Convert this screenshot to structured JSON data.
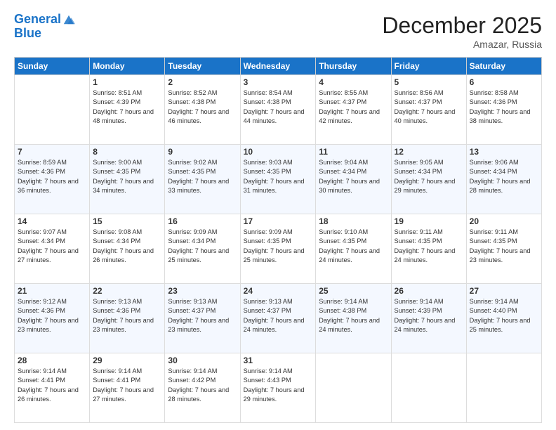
{
  "logo": {
    "line1": "General",
    "line2": "Blue"
  },
  "header": {
    "month": "December 2025",
    "location": "Amazar, Russia"
  },
  "weekdays": [
    "Sunday",
    "Monday",
    "Tuesday",
    "Wednesday",
    "Thursday",
    "Friday",
    "Saturday"
  ],
  "weeks": [
    [
      {
        "day": "",
        "sunrise": "",
        "sunset": "",
        "daylight": ""
      },
      {
        "day": "1",
        "sunrise": "Sunrise: 8:51 AM",
        "sunset": "Sunset: 4:39 PM",
        "daylight": "Daylight: 7 hours and 48 minutes."
      },
      {
        "day": "2",
        "sunrise": "Sunrise: 8:52 AM",
        "sunset": "Sunset: 4:38 PM",
        "daylight": "Daylight: 7 hours and 46 minutes."
      },
      {
        "day": "3",
        "sunrise": "Sunrise: 8:54 AM",
        "sunset": "Sunset: 4:38 PM",
        "daylight": "Daylight: 7 hours and 44 minutes."
      },
      {
        "day": "4",
        "sunrise": "Sunrise: 8:55 AM",
        "sunset": "Sunset: 4:37 PM",
        "daylight": "Daylight: 7 hours and 42 minutes."
      },
      {
        "day": "5",
        "sunrise": "Sunrise: 8:56 AM",
        "sunset": "Sunset: 4:37 PM",
        "daylight": "Daylight: 7 hours and 40 minutes."
      },
      {
        "day": "6",
        "sunrise": "Sunrise: 8:58 AM",
        "sunset": "Sunset: 4:36 PM",
        "daylight": "Daylight: 7 hours and 38 minutes."
      }
    ],
    [
      {
        "day": "7",
        "sunrise": "Sunrise: 8:59 AM",
        "sunset": "Sunset: 4:36 PM",
        "daylight": "Daylight: 7 hours and 36 minutes."
      },
      {
        "day": "8",
        "sunrise": "Sunrise: 9:00 AM",
        "sunset": "Sunset: 4:35 PM",
        "daylight": "Daylight: 7 hours and 34 minutes."
      },
      {
        "day": "9",
        "sunrise": "Sunrise: 9:02 AM",
        "sunset": "Sunset: 4:35 PM",
        "daylight": "Daylight: 7 hours and 33 minutes."
      },
      {
        "day": "10",
        "sunrise": "Sunrise: 9:03 AM",
        "sunset": "Sunset: 4:35 PM",
        "daylight": "Daylight: 7 hours and 31 minutes."
      },
      {
        "day": "11",
        "sunrise": "Sunrise: 9:04 AM",
        "sunset": "Sunset: 4:34 PM",
        "daylight": "Daylight: 7 hours and 30 minutes."
      },
      {
        "day": "12",
        "sunrise": "Sunrise: 9:05 AM",
        "sunset": "Sunset: 4:34 PM",
        "daylight": "Daylight: 7 hours and 29 minutes."
      },
      {
        "day": "13",
        "sunrise": "Sunrise: 9:06 AM",
        "sunset": "Sunset: 4:34 PM",
        "daylight": "Daylight: 7 hours and 28 minutes."
      }
    ],
    [
      {
        "day": "14",
        "sunrise": "Sunrise: 9:07 AM",
        "sunset": "Sunset: 4:34 PM",
        "daylight": "Daylight: 7 hours and 27 minutes."
      },
      {
        "day": "15",
        "sunrise": "Sunrise: 9:08 AM",
        "sunset": "Sunset: 4:34 PM",
        "daylight": "Daylight: 7 hours and 26 minutes."
      },
      {
        "day": "16",
        "sunrise": "Sunrise: 9:09 AM",
        "sunset": "Sunset: 4:34 PM",
        "daylight": "Daylight: 7 hours and 25 minutes."
      },
      {
        "day": "17",
        "sunrise": "Sunrise: 9:09 AM",
        "sunset": "Sunset: 4:35 PM",
        "daylight": "Daylight: 7 hours and 25 minutes."
      },
      {
        "day": "18",
        "sunrise": "Sunrise: 9:10 AM",
        "sunset": "Sunset: 4:35 PM",
        "daylight": "Daylight: 7 hours and 24 minutes."
      },
      {
        "day": "19",
        "sunrise": "Sunrise: 9:11 AM",
        "sunset": "Sunset: 4:35 PM",
        "daylight": "Daylight: 7 hours and 24 minutes."
      },
      {
        "day": "20",
        "sunrise": "Sunrise: 9:11 AM",
        "sunset": "Sunset: 4:35 PM",
        "daylight": "Daylight: 7 hours and 23 minutes."
      }
    ],
    [
      {
        "day": "21",
        "sunrise": "Sunrise: 9:12 AM",
        "sunset": "Sunset: 4:36 PM",
        "daylight": "Daylight: 7 hours and 23 minutes."
      },
      {
        "day": "22",
        "sunrise": "Sunrise: 9:13 AM",
        "sunset": "Sunset: 4:36 PM",
        "daylight": "Daylight: 7 hours and 23 minutes."
      },
      {
        "day": "23",
        "sunrise": "Sunrise: 9:13 AM",
        "sunset": "Sunset: 4:37 PM",
        "daylight": "Daylight: 7 hours and 23 minutes."
      },
      {
        "day": "24",
        "sunrise": "Sunrise: 9:13 AM",
        "sunset": "Sunset: 4:37 PM",
        "daylight": "Daylight: 7 hours and 24 minutes."
      },
      {
        "day": "25",
        "sunrise": "Sunrise: 9:14 AM",
        "sunset": "Sunset: 4:38 PM",
        "daylight": "Daylight: 7 hours and 24 minutes."
      },
      {
        "day": "26",
        "sunrise": "Sunrise: 9:14 AM",
        "sunset": "Sunset: 4:39 PM",
        "daylight": "Daylight: 7 hours and 24 minutes."
      },
      {
        "day": "27",
        "sunrise": "Sunrise: 9:14 AM",
        "sunset": "Sunset: 4:40 PM",
        "daylight": "Daylight: 7 hours and 25 minutes."
      }
    ],
    [
      {
        "day": "28",
        "sunrise": "Sunrise: 9:14 AM",
        "sunset": "Sunset: 4:41 PM",
        "daylight": "Daylight: 7 hours and 26 minutes."
      },
      {
        "day": "29",
        "sunrise": "Sunrise: 9:14 AM",
        "sunset": "Sunset: 4:41 PM",
        "daylight": "Daylight: 7 hours and 27 minutes."
      },
      {
        "day": "30",
        "sunrise": "Sunrise: 9:14 AM",
        "sunset": "Sunset: 4:42 PM",
        "daylight": "Daylight: 7 hours and 28 minutes."
      },
      {
        "day": "31",
        "sunrise": "Sunrise: 9:14 AM",
        "sunset": "Sunset: 4:43 PM",
        "daylight": "Daylight: 7 hours and 29 minutes."
      },
      {
        "day": "",
        "sunrise": "",
        "sunset": "",
        "daylight": ""
      },
      {
        "day": "",
        "sunrise": "",
        "sunset": "",
        "daylight": ""
      },
      {
        "day": "",
        "sunrise": "",
        "sunset": "",
        "daylight": ""
      }
    ]
  ]
}
